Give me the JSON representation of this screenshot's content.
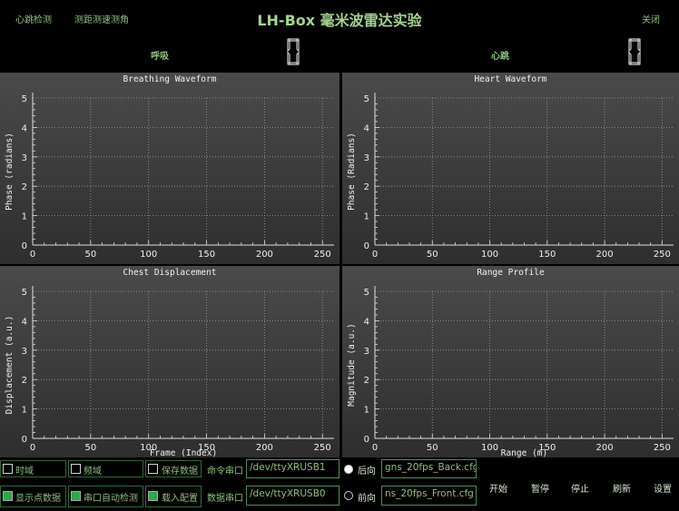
{
  "header": {
    "nav_vital": "心跳检测",
    "nav_range": "测距测速测角",
    "title": "LH-Box 毫米波雷达实验",
    "close": "关闭",
    "breath_label": "呼吸",
    "heart_label": "心跳"
  },
  "plots": [
    {
      "title": "Breathing Waveform",
      "ylabel": "Phase (radians)",
      "xlabel": "",
      "xticks": [
        "0",
        "50",
        "100",
        "150",
        "200",
        "250"
      ],
      "yticks": [
        "0",
        "1",
        "2",
        "3",
        "4",
        "5"
      ]
    },
    {
      "title": "Heart Waveform",
      "ylabel": "Phase (Radians)",
      "xlabel": "",
      "xticks": [
        "0",
        "50",
        "100",
        "150",
        "200",
        "250"
      ],
      "yticks": [
        "0",
        "1",
        "2",
        "3",
        "4",
        "5"
      ]
    },
    {
      "title": "Chest Displacement",
      "ylabel": "Displacement (a.u.)",
      "xlabel": "Frame (Index)",
      "xticks": [
        "0",
        "50",
        "100",
        "150",
        "200",
        "250"
      ],
      "yticks": [
        "0",
        "1",
        "2",
        "3",
        "4",
        "5"
      ]
    },
    {
      "title": "Range Profile",
      "ylabel": "Magnitude (a.u.)",
      "xlabel": "Range (m)",
      "xticks": [
        "0",
        "50",
        "100",
        "150",
        "200",
        "250"
      ],
      "yticks": [
        "0",
        "1",
        "2",
        "3",
        "4",
        "5"
      ]
    }
  ],
  "controls": {
    "time_domain": "时域",
    "freq_domain": "频域",
    "save_data": "保存数据",
    "show_points": "显示点数据",
    "auto_detect": "串口自动检测",
    "load_config": "载入配置",
    "cmd_port_label": "命令串口",
    "cmd_port": "/dev/ttyXRUSB1",
    "data_port_label": "数据串口",
    "data_port": "/dev/ttyXRUSB0",
    "back_label": "后向",
    "front_label": "前向",
    "back_cfg": "gns_20fps_Back.cfg",
    "front_cfg": "ns_20fps_Front.cfg"
  },
  "buttons": {
    "start": "开始",
    "pause": "暂停",
    "stop": "停止",
    "refresh": "刷新",
    "settings": "设置"
  },
  "colors": {
    "accent": "#8fbf7f",
    "checked": "#2aa84a"
  }
}
